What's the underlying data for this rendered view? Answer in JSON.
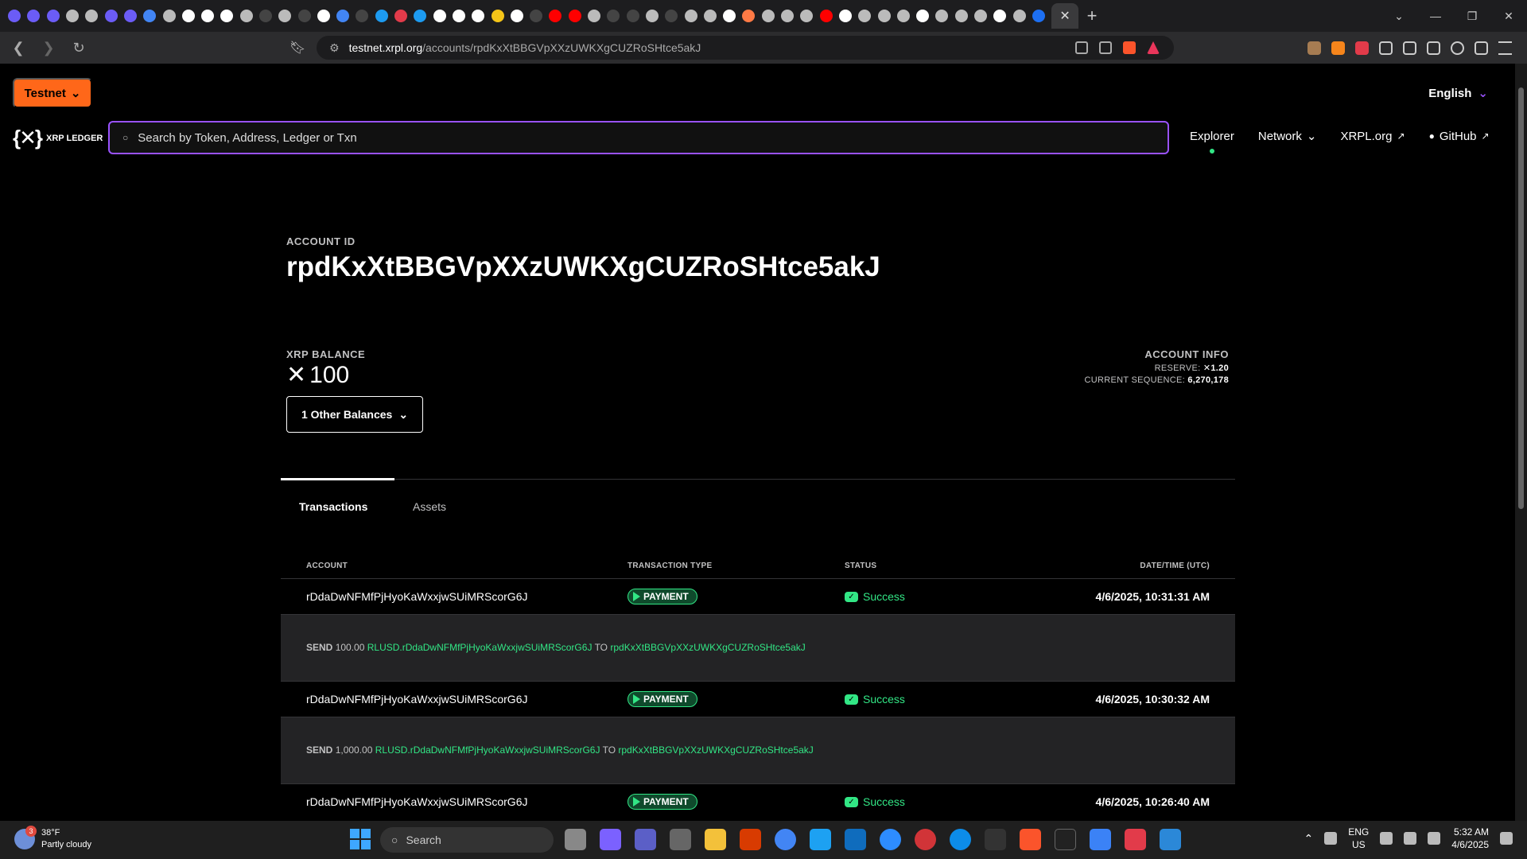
{
  "browser": {
    "tab_favicons": [
      "#6b5cf6",
      "#6b5cf6",
      "#6b5cf6",
      "#bbbbbb",
      "#bbbbbb",
      "#6b5cf6",
      "#6b5cf6",
      "#4285f4",
      "#bbbbbb",
      "#ffffff",
      "#ffffff",
      "#ffffff",
      "#bbbbbb",
      "#444444",
      "#bbbbbb",
      "#444444",
      "#ffffff",
      "#4285f4",
      "#444444",
      "#1d9bf0",
      "#e23b4a",
      "#1d9bf0",
      "#ffffff",
      "#ffffff",
      "#ffffff",
      "#f5c518",
      "#ffffff",
      "#444444",
      "#ff0000",
      "#ff0000",
      "#bbbbbb",
      "#444444",
      "#444444",
      "#bbbbbb",
      "#444444",
      "#bbbbbb",
      "#bbbbbb",
      "#ffffff",
      "#ff7a45",
      "#bbbbbb",
      "#bbbbbb",
      "#bbbbbb",
      "#ff0000",
      "#ffffff",
      "#bbbbbb",
      "#bbbbbb",
      "#bbbbbb",
      "#ffffff",
      "#bbbbbb",
      "#bbbbbb",
      "#bbbbbb",
      "#ffffff",
      "#bbbbbb",
      "#1d6ff2"
    ],
    "active_tab_close": "✕",
    "new_tab": "+",
    "url_host": "testnet.xrpl.org",
    "url_path": "/accounts/rpdKxXtBBGVpXXzUWKXgCUZRoSHtce5akJ"
  },
  "header": {
    "network_button": "Testnet",
    "language": "English",
    "logo_text": "XRP LEDGER",
    "search_placeholder": "Search by Token, Address, Ledger or Txn",
    "nav": {
      "explorer": "Explorer",
      "network": "Network",
      "xrpl_org": "XRPL.org",
      "github": "GitHub"
    }
  },
  "account": {
    "label": "ACCOUNT ID",
    "id": "rpdKxXtBBGVpXXzUWKXgCUZRoSHtce5akJ",
    "balance_label": "XRP BALANCE",
    "balance": "100",
    "other_balances": "1 Other Balances",
    "info_title": "ACCOUNT INFO",
    "reserve_label": "RESERVE:",
    "reserve_value": "1.20",
    "sequence_label": "CURRENT SEQUENCE:",
    "sequence_value": "6,270,178"
  },
  "tabs": {
    "transactions": "Transactions",
    "assets": "Assets"
  },
  "table": {
    "headers": {
      "account": "ACCOUNT",
      "type": "TRANSACTION TYPE",
      "status": "STATUS",
      "date": "DATE/TIME (UTC)"
    },
    "rows": [
      {
        "account": "rDdaDwNFMfPjHyoKaWxxjwSUiMRScorG6J",
        "type": "PAYMENT",
        "status": "Success",
        "date": "4/6/2025, 10:31:31 AM",
        "send_word": "SEND",
        "amount": "100.00",
        "currency": "RLUSD.rDdaDwNFMfPjHyoKaWxxjwSUiMRScorG6J",
        "to_word": "TO",
        "dest": "rpdKxXtBBGVpXXzUWKXgCUZRoSHtce5akJ"
      },
      {
        "account": "rDdaDwNFMfPjHyoKaWxxjwSUiMRScorG6J",
        "type": "PAYMENT",
        "status": "Success",
        "date": "4/6/2025, 10:30:32 AM",
        "send_word": "SEND",
        "amount": "1,000.00",
        "currency": "RLUSD.rDdaDwNFMfPjHyoKaWxxjwSUiMRScorG6J",
        "to_word": "TO",
        "dest": "rpdKxXtBBGVpXXzUWKXgCUZRoSHtce5akJ"
      },
      {
        "account": "rDdaDwNFMfPjHyoKaWxxjwSUiMRScorG6J",
        "type": "PAYMENT",
        "status": "Success",
        "date": "4/6/2025, 10:26:40 AM"
      }
    ]
  },
  "taskbar": {
    "temp": "38°F",
    "weather": "Partly cloudy",
    "weather_badge": "3",
    "search": "Search",
    "lang_top": "ENG",
    "lang_bottom": "US",
    "time": "5:32 AM",
    "date": "4/6/2025"
  },
  "colors": {
    "accent": "#9a52ff",
    "testnet": "#ff6719",
    "success": "#32e685"
  }
}
